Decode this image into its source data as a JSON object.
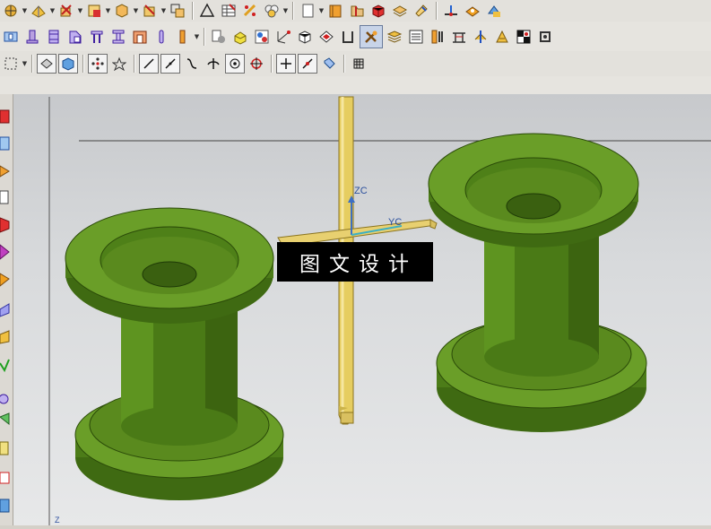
{
  "toolbars": {
    "row1": [
      "point-constructor-icon",
      "datum-plane-icon",
      "extrude-icon",
      "revolve-icon",
      "feature-icon",
      "sketch-icon",
      "transform-icon",
      "triangle-icon",
      "table-icon",
      "pattern-icon",
      "group-icon",
      "sheet-icon",
      "book-icon",
      "folder-icon",
      "cube-icon",
      "layer-icon",
      "paint-icon",
      "measure-icon",
      "analysis-icon",
      "view-icon"
    ],
    "row2": [
      "mold-icon",
      "core-icon",
      "cavity-icon",
      "slide-icon",
      "ejector-icon",
      "gate-icon",
      "runner-icon",
      "pin-icon",
      "list-icon",
      "parts-icon",
      "tools-icon",
      "coordinate-icon",
      "box-icon",
      "shape-icon",
      "frame-icon",
      "wrench-icon",
      "layer-stack-icon",
      "list-view-icon",
      "insert-icon",
      "bridge-icon",
      "cooling-icon",
      "electrode-icon",
      "checker-icon",
      "cycle-icon"
    ],
    "row3": [
      "select-box-icon",
      "render-icon",
      "shading-icon",
      "snap-icon",
      "points-icon",
      "line-icon",
      "slash-icon",
      "curve-icon",
      "cross-icon",
      "circle-point-icon",
      "target-icon",
      "plus-icon",
      "diagonal-icon",
      "tag-icon",
      "grid-icon"
    ]
  },
  "viewport": {
    "triad": {
      "zc_label": "ZC",
      "yc_label": "YC"
    },
    "corner_axis_label": "Z",
    "watermark_text": "图文设计",
    "colors": {
      "part": "#5a8a1e",
      "part_dark": "#3d6310",
      "part_light": "#7aa832",
      "datum": "#e3c85a"
    }
  }
}
